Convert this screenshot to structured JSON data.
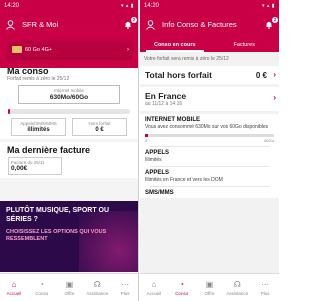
{
  "left": {
    "status_time": "14:20",
    "title": "SFR & Moi",
    "notif_count": "2",
    "sim_label": "60 Go 4G+",
    "conso_title": "Ma conso",
    "reset_note": "Forfait remis à zéro le 25/12",
    "internet_label": "Internet mobile",
    "internet_value": "630Mo/60Go",
    "internet_fraction": 0.01,
    "calls_label": "Appels/SMS/MMS",
    "calls_value": "illimités",
    "hors_label": "Hors forfait",
    "hors_value": "0 €",
    "facture_title": "Ma dernière facture",
    "facture_label": "Facture du 25/11",
    "facture_value": "0,00€",
    "promo_headline": "PLUTÔT MUSIQUE, SPORT OU SÉRIES ?",
    "promo_text": "CHOISISSEZ LES OPTIONS QUI VOUS RESSEMBLENT",
    "nav": [
      "Accueil",
      "Conso",
      "Offre",
      "Assistance",
      "Plus"
    ]
  },
  "right": {
    "status_time": "14:20",
    "title": "Info Conso & Factures",
    "notif_count": "2",
    "tabs": [
      "Conso en cours",
      "Factures"
    ],
    "reset_note": "Votre forfait sera remis à zéro le 25/12",
    "total_label": "Total hors forfait",
    "total_value": "0 €",
    "france_title": "En France",
    "france_sub": "au 11/12 à 14:16",
    "internet_title": "INTERNET MOBILE",
    "internet_text": "Vous avez consommé 630Mo sur vos 60Go disponibles",
    "scale_start": "0",
    "scale_end": "60Go",
    "appels1_title": "APPELS",
    "appels1_text": "Illimités",
    "appels2_title": "APPELS",
    "appels2_text": "Illimités en France et vers les DOM",
    "sms_title": "SMS/MMS",
    "nav": [
      "Accueil",
      "Conso",
      "Offre",
      "Assistance",
      "Plus"
    ]
  },
  "colors": {
    "brand": "#ca0047",
    "promo_bg": "#2c0a4a"
  },
  "icons": [
    "user-icon",
    "bell-icon",
    "chevron-right-icon",
    "home-icon",
    "chart-icon",
    "offer-icon",
    "help-icon",
    "more-icon"
  ]
}
